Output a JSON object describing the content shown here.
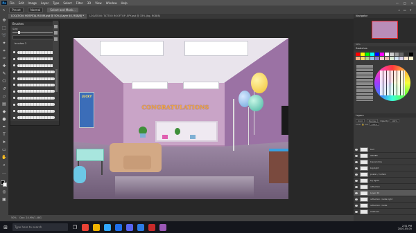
{
  "menubar": {
    "logo": "Ps",
    "items": [
      "File",
      "Edit",
      "Image",
      "Layer",
      "Type",
      "Select",
      "Filter",
      "3D",
      "View",
      "Window",
      "Help"
    ],
    "window_controls": [
      "—",
      "□",
      "✕"
    ]
  },
  "optbar": {
    "tool_icon": "brush-icon",
    "preset": "Preset",
    "mode": "Normal",
    "select_mask": "Select and Mask..."
  },
  "tabs": [
    {
      "label": "LOCATION: HOSPITAL ROOM.psd @ 50% (Layer 40, RGB/8) *",
      "active": true
    },
    {
      "label": "LOCATION: TATTOO ROOFTOP .EPY.psd @ 33% (bg, RGB/8)",
      "active": false
    }
  ],
  "brush_panel": {
    "title": "Brushes",
    "size_label": "Size:",
    "group_label": "brushes 2",
    "stroke_count": 11
  },
  "canvas": {
    "banner_text": "CONGRATULATIONS",
    "poster_text": "LUCKY"
  },
  "navigator": {
    "title": "Navigator",
    "zoom": "50%"
  },
  "swatches": {
    "title": "Swatches",
    "colors": [
      "#ff0000",
      "#ffff00",
      "#00ff00",
      "#00ffff",
      "#0000ff",
      "#ff00ff",
      "#ffffff",
      "#cccccc",
      "#999999",
      "#666666",
      "#333333",
      "#000000",
      "#f4b183",
      "#ffd966",
      "#a9d08e",
      "#9bc2e6",
      "#8e7cc3",
      "#f4cccc",
      "#e6b8af",
      "#d9ead3",
      "#cfe2f3",
      "#d9d2e9",
      "#fce5cd",
      "#fff2cc"
    ]
  },
  "layers": {
    "title": "Layers",
    "kind": "Kind",
    "blend": "Normal",
    "opacity_label": "Opacity:",
    "opacity": "100%",
    "lock_label": "Lock:",
    "fill_label": "Fill:",
    "fill": "100%",
    "items": [
      {
        "name": "bed",
        "active": false
      },
      {
        "name": "ORDER",
        "active": false
      },
      {
        "name": "big window",
        "active": false
      },
      {
        "name": "big light",
        "active": false
      },
      {
        "name": "poster / curtain",
        "active": false
      },
      {
        "name": "bg lights",
        "active": false
      },
      {
        "name": "reflection",
        "active": false
      },
      {
        "name": "Layer 40",
        "active": true
      },
      {
        "name": "reflection cradle light",
        "active": false
      },
      {
        "name": "reflection cradle",
        "active": false
      },
      {
        "name": "shadows",
        "active": false
      }
    ]
  },
  "statusbar": {
    "zoom": "50%",
    "doc_info": "Doc: 24.9M/1.48G"
  },
  "taskbar": {
    "search_placeholder": "Type here to search",
    "time": "2:51 PM",
    "date": "2020-05-05"
  }
}
